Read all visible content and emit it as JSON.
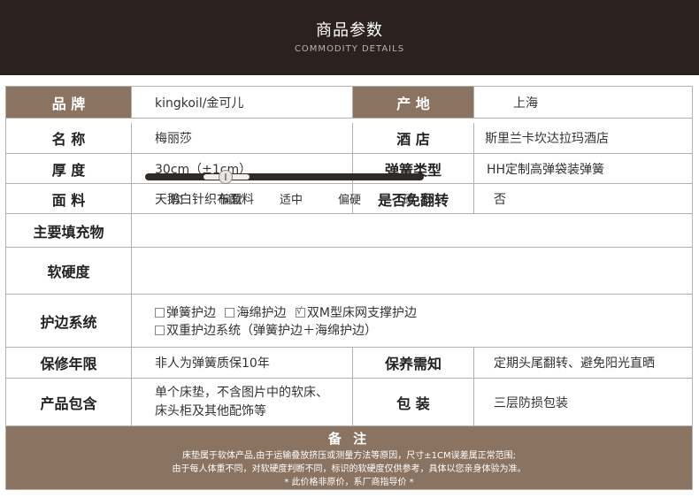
{
  "header": {
    "title": "商品参数",
    "subtitle": "COMMODITY DETAILS"
  },
  "rows": {
    "brand_label": "品  牌",
    "brand_value": "kingkoil/金可儿",
    "origin_label": "产  地",
    "origin_value": "上海",
    "name_label": "名  称",
    "name_value": "梅丽莎",
    "hotel_label": "酒  店",
    "hotel_value": "斯里兰卡坎达拉玛酒店",
    "thickness_label": "厚  度",
    "thickness_value": "30cm（±1cm）",
    "spring_label": "弹簧类型",
    "spring_value": "HH定制高弹袋装弹簧",
    "fabric_label": "面  料",
    "fabric_value": "天鹅白针织布面料",
    "flip_label": "是否免翻转",
    "flip_value": "否",
    "filling_label": "主要填充物",
    "filling_value": "",
    "firmness_label": "软硬度",
    "edge_label": "护边系统",
    "warranty_label": "保修年限",
    "warranty_value": "非人为弹簧质保10年",
    "care_label": "保养需知",
    "care_value": "定期头尾翻转、避免阳光直晒",
    "package_label": "产品包含",
    "package_value_line1": "单个床垫，不含图片中的软床、",
    "package_value_line2": "床头柜及其他配饰等",
    "packing_label": "包  装",
    "packing_value": "三层防损包装"
  },
  "firmness": {
    "ticks": [
      "软",
      "偏软",
      "适中",
      "偏硬",
      "硬"
    ],
    "selected_index": 1
  },
  "edge_options": [
    {
      "label": "弹簧护边",
      "checked": false
    },
    {
      "label": "海绵护边",
      "checked": false
    },
    {
      "label": "双M型床网支撑护边",
      "checked": true
    },
    {
      "label": "双重护边系统（弹簧护边＋海绵护边）",
      "checked": false
    }
  ],
  "notes": {
    "title": "备 注",
    "line1": "床垫属于软体产品,由于运输叠放挤压或测量方法等原因，尺寸±1CM误差属正常范围;",
    "line2": "由于每人体重不同，对软硬度判断不同，标识的软硬度仅供参考，具体以您亲身体验为准。",
    "line3": "* 此价格非原价，系厂商指导价 *"
  },
  "colors": {
    "header_bg": "#2b2220",
    "accent": "#8a7361",
    "border": "#b6b0aa"
  }
}
